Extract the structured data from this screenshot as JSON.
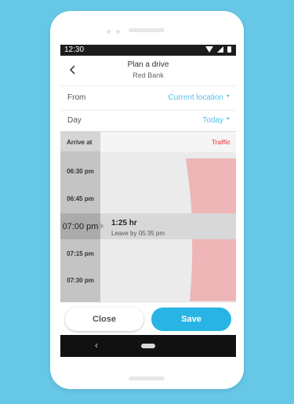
{
  "status_bar": {
    "time": "12:30"
  },
  "header": {
    "title": "Plan a drive",
    "subtitle": "Red Bank",
    "back_icon": "arrow-left-icon"
  },
  "form": {
    "from": {
      "label": "From",
      "value": "Current location"
    },
    "day": {
      "label": "Day",
      "value": "Today"
    }
  },
  "schedule": {
    "arrive_header": "Arrive at",
    "traffic_header": "Traffic",
    "traffic_color": "#f25c5c",
    "times": [
      "06:30 pm",
      "06:45 pm",
      "07:00 pm",
      "07:15 pm",
      "07:30 pm"
    ],
    "selected_index": 2,
    "selected": {
      "duration": "1:25 hr",
      "leave_by": "Leave by 05:35 pm"
    }
  },
  "actions": {
    "close_label": "Close",
    "save_label": "Save",
    "accent": "#28b5e5"
  }
}
